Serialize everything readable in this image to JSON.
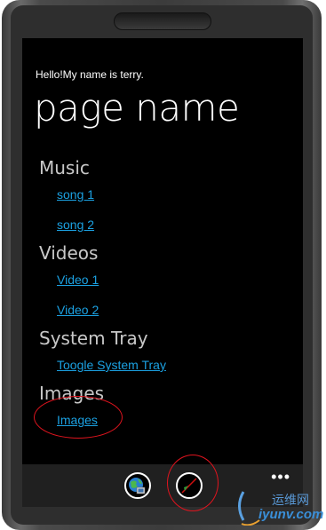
{
  "app_title": "Hello!My name is terry.",
  "page_title": "page name",
  "sections": [
    {
      "heading": "Music",
      "links": [
        "song 1",
        "song 2"
      ]
    },
    {
      "heading": "Videos",
      "links": [
        "Video 1",
        "Video 2"
      ]
    },
    {
      "heading": "System Tray",
      "links": [
        "Toogle System Tray"
      ]
    },
    {
      "heading": "Images",
      "links": [
        "Images"
      ]
    }
  ],
  "appbar": {
    "buttons": [
      {
        "icon": "globe-icon"
      },
      {
        "icon": "check-icon"
      }
    ],
    "more_label": "•••"
  },
  "watermark": {
    "cn_text": "运维网",
    "en_text": "iyunv.com"
  }
}
